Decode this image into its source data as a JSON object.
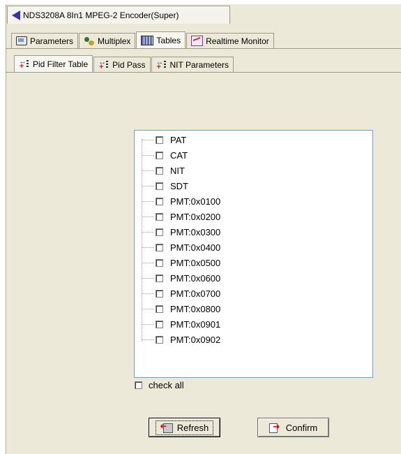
{
  "window": {
    "title": "NDS3208A 8In1 MPEG-2 Encoder(Super)",
    "title_icon": "back-arrow-icon"
  },
  "main_tabs": [
    {
      "label": "Parameters",
      "icon": "parameters-icon",
      "active": false
    },
    {
      "label": "Multiplex",
      "icon": "multiplex-icon",
      "active": false
    },
    {
      "label": "Tables",
      "icon": "tables-icon",
      "active": true
    },
    {
      "label": "Realtime Monitor",
      "icon": "realtime-monitor-icon",
      "active": false
    }
  ],
  "sub_tabs": [
    {
      "label": "Pid Filter Table",
      "icon": "pid-icon",
      "active": true
    },
    {
      "label": "Pid Pass",
      "icon": "pid-icon",
      "active": false
    },
    {
      "label": "NIT Parameters",
      "icon": "pid-icon",
      "active": false
    }
  ],
  "pid_list": {
    "items": [
      {
        "label": "PAT",
        "checked": false
      },
      {
        "label": "CAT",
        "checked": false
      },
      {
        "label": "NIT",
        "checked": false
      },
      {
        "label": "SDT",
        "checked": false
      },
      {
        "label": "PMT:0x0100",
        "checked": false
      },
      {
        "label": "PMT:0x0200",
        "checked": false
      },
      {
        "label": "PMT:0x0300",
        "checked": false
      },
      {
        "label": "PMT:0x0400",
        "checked": false
      },
      {
        "label": "PMT:0x0500",
        "checked": false
      },
      {
        "label": "PMT:0x0600",
        "checked": false
      },
      {
        "label": "PMT:0x0700",
        "checked": false
      },
      {
        "label": "PMT:0x0800",
        "checked": false
      },
      {
        "label": "PMT:0x0901",
        "checked": false
      },
      {
        "label": "PMT:0x0902",
        "checked": false
      }
    ]
  },
  "check_all": {
    "label": "check all",
    "checked": false
  },
  "buttons": {
    "refresh": "Refresh",
    "confirm": "Confirm"
  }
}
